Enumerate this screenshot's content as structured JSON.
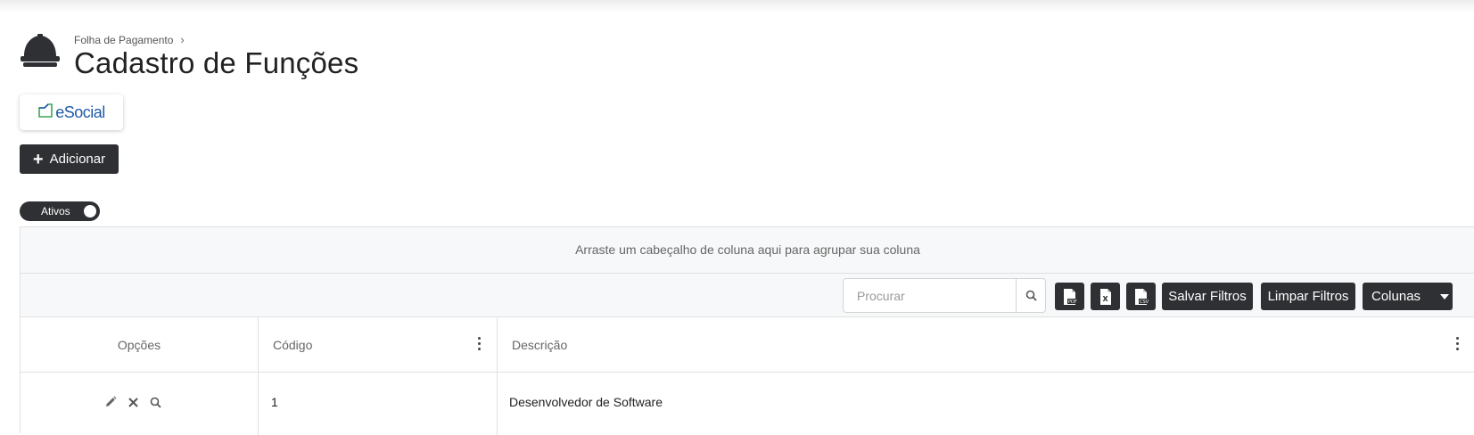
{
  "header": {
    "breadcrumb": "Folha de Pagamento",
    "title": "Cadastro de Funções"
  },
  "esocial": {
    "label": "eSocial"
  },
  "actions": {
    "add_label": "Adicionar"
  },
  "toggle": {
    "label": "Ativos",
    "on": true
  },
  "grid": {
    "group_panel_text": "Arraste um cabeçalho de coluna aqui para agrupar sua coluna",
    "toolbar": {
      "search_placeholder": "Procurar",
      "export_buttons": [
        "pdf-export-icon",
        "excel-export-icon",
        "csv-export-icon"
      ],
      "save_filters_label": "Salvar Filtros",
      "clear_filters_label": "Limpar Filtros",
      "columns_label": "Colunas"
    },
    "columns": [
      "Opções",
      "Código",
      "Descrição"
    ],
    "rows": [
      {
        "codigo": "1",
        "descricao": "Desenvolvedor de Software"
      }
    ]
  },
  "colors": {
    "dark": "#2f3033",
    "border": "#e0e0e0",
    "panel": "#f7f8f9",
    "esocial_blue": "#1e5aa8",
    "esocial_green": "#3aa655"
  }
}
